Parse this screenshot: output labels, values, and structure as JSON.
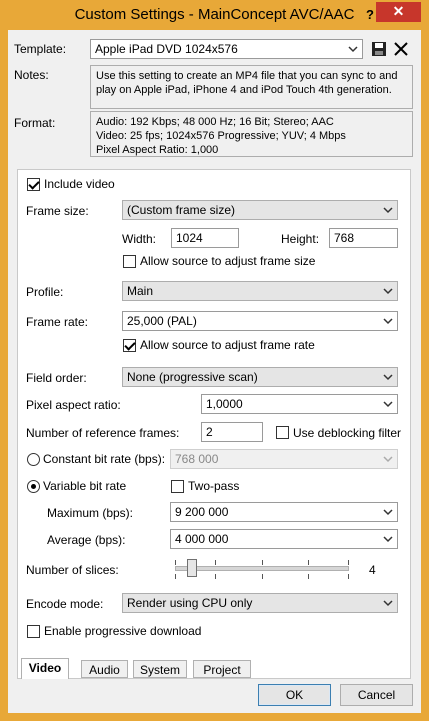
{
  "window": {
    "title": "Custom Settings - MainConcept AVC/AAC",
    "help_glyph": "?",
    "close_glyph": "✕"
  },
  "header": {
    "template_label": "Template:",
    "template_value": "Apple iPad DVD 1024x576",
    "notes_label": "Notes:",
    "notes_text": "Use this setting to create an MP4 file that you can sync to and play on Apple iPad, iPhone 4 and iPod Touch 4th generation.",
    "format_label": "Format:",
    "format_lines": [
      "Audio: 192 Kbps; 48 000 Hz; 16 Bit; Stereo; AAC",
      "Video: 25 fps; 1024x576 Progressive; YUV; 4 Mbps",
      "Pixel Aspect Ratio: 1,000"
    ],
    "save_icon": "save-icon",
    "delete_icon": "delete-icon"
  },
  "video": {
    "include_video_label": "Include video",
    "include_video_checked": true,
    "frame_size_label": "Frame size:",
    "frame_size_value": "(Custom frame size)",
    "width_label": "Width:",
    "width_value": "1024",
    "height_label": "Height:",
    "height_value": "768",
    "allow_source_frame_size_label": "Allow source to adjust frame size",
    "allow_source_frame_size_checked": false,
    "profile_label": "Profile:",
    "profile_value": "Main",
    "frame_rate_label": "Frame rate:",
    "frame_rate_value": "25,000 (PAL)",
    "allow_source_frame_rate_label": "Allow source to adjust frame rate",
    "allow_source_frame_rate_checked": true,
    "field_order_label": "Field order:",
    "field_order_value": "None (progressive scan)",
    "pixel_aspect_label": "Pixel aspect ratio:",
    "pixel_aspect_value": "1,0000",
    "ref_frames_label": "Number of reference frames:",
    "ref_frames_value": "2",
    "deblocking_label": "Use deblocking filter",
    "deblocking_checked": false,
    "cbr_label": "Constant bit rate (bps):",
    "cbr_value": "768 000",
    "cbr_selected": false,
    "vbr_label": "Variable bit rate",
    "vbr_selected": true,
    "two_pass_label": "Two-pass",
    "two_pass_checked": false,
    "maximum_label": "Maximum (bps):",
    "maximum_value": "9 200 000",
    "average_label": "Average (bps):",
    "average_value": "4 000 000",
    "slices_label": "Number of slices:",
    "slices_value": "4",
    "slices_level": 0.07,
    "encode_mode_label": "Encode mode:",
    "encode_mode_value": "Render using CPU only",
    "progressive_download_label": "Enable progressive download",
    "progressive_download_checked": false
  },
  "tabs": [
    "Video",
    "Audio",
    "System",
    "Project"
  ],
  "active_tab": "Video",
  "buttons": {
    "ok": "OK",
    "cancel": "Cancel"
  },
  "colors": {
    "title_bar": "#e8a838",
    "close_button": "#c7362b",
    "default_button_border": "#3c7fb1"
  }
}
